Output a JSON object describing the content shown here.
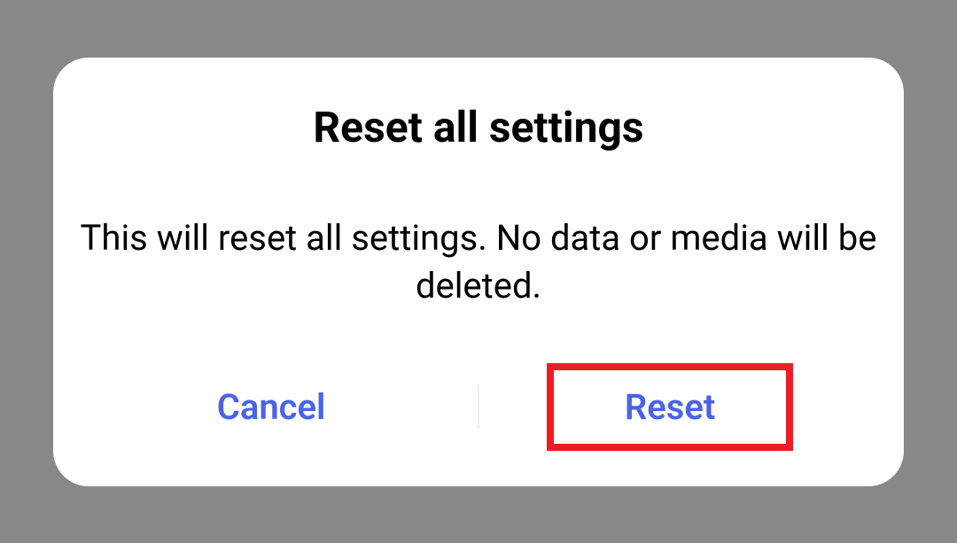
{
  "dialog": {
    "title": "Reset all settings",
    "message": "This will reset all settings. No data or media will be deleted.",
    "cancel_label": "Cancel",
    "confirm_label": "Reset",
    "button_color": "#4a63e7",
    "highlight_color": "#ed1c24"
  }
}
